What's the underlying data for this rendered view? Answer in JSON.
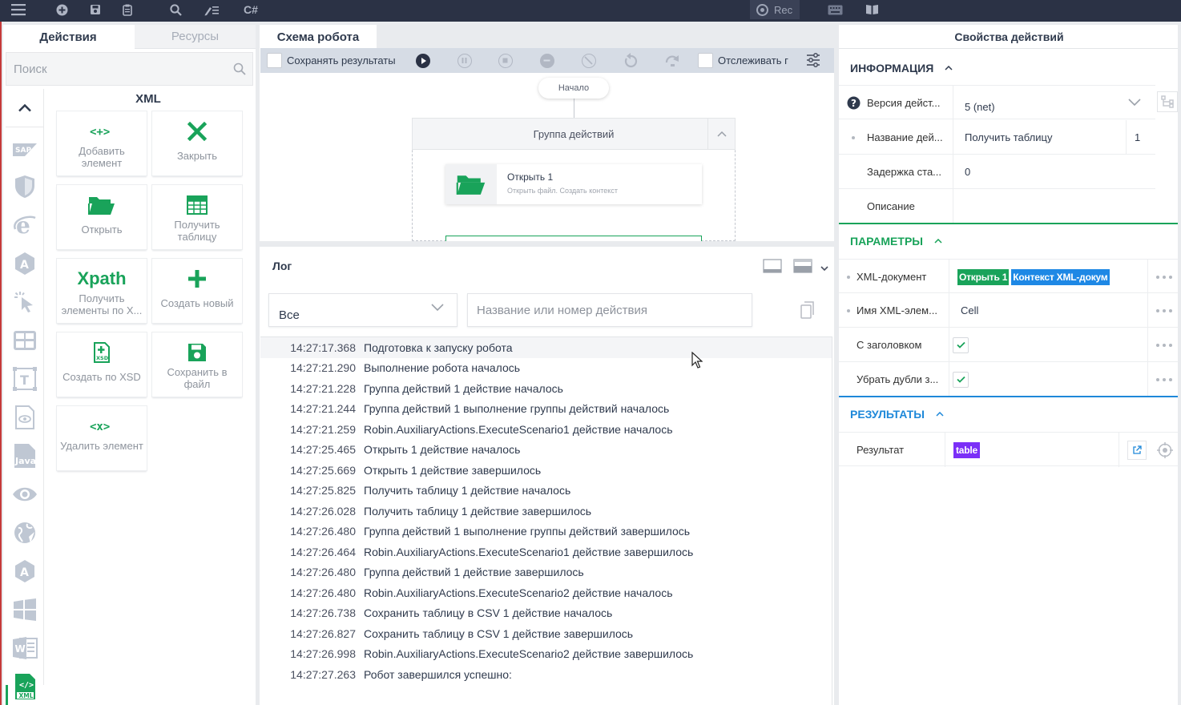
{
  "topbar": {
    "rec_label": "Rec"
  },
  "left_panel": {
    "tabs": [
      "Действия",
      "Ресурсы"
    ],
    "search_placeholder": "Поиск",
    "category_title": "XML",
    "tiles": [
      {
        "label": "Добавить элемент",
        "icon": "add-element-icon"
      },
      {
        "label": "Закрыть",
        "icon": "close-x-icon"
      },
      {
        "label": "Открыть",
        "icon": "folder-open-icon"
      },
      {
        "label": "Получить таблицу",
        "icon": "table-icon"
      },
      {
        "label": "Получить элементы по X...",
        "icon": "xpath-icon",
        "icon_text": "Xpath"
      },
      {
        "label": "Создать новый",
        "icon": "plus-icon"
      },
      {
        "label": "Создать по XSD",
        "icon": "xsd-file-icon"
      },
      {
        "label": "Сохранить в файл",
        "icon": "floppy-icon"
      },
      {
        "label": "Удалить элемент",
        "icon": "remove-element-icon"
      }
    ]
  },
  "schema": {
    "tab_label": "Схема робота",
    "save_results_label": "Сохранять результаты",
    "track_label": "Отслеживать г",
    "start_node": "Начало",
    "group_label": "Группа действий",
    "open_node_title": "Открыть  1",
    "open_node_desc": "Открыть файл. Создать контекст"
  },
  "log": {
    "title": "Лог",
    "filter_value": "Все",
    "search_placeholder": "Название или номер действия",
    "rows": [
      {
        "time": "14:27:17.368",
        "msg": "Подготовка к запуску робота"
      },
      {
        "time": "14:27:21.290",
        "msg": "Выполнение робота началось"
      },
      {
        "time": "14:27:21.228",
        "msg": "Группа действий 1 действие началось"
      },
      {
        "time": "14:27:21.244",
        "msg": "Группа действий 1 выполнение группы действий началось"
      },
      {
        "time": "14:27:21.259",
        "msg": "Robin.AuxiliaryActions.ExecuteScenario1 действие началось"
      },
      {
        "time": "14:27:25.465",
        "msg": "Открыть 1 действие началось"
      },
      {
        "time": "14:27:25.669",
        "msg": "Открыть 1 действие завершилось"
      },
      {
        "time": "14:27:25.825",
        "msg": "Получить таблицу 1 действие началось"
      },
      {
        "time": "14:27:26.028",
        "msg": "Получить таблицу 1 действие завершилось"
      },
      {
        "time": "14:27:26.480",
        "msg": "Группа действий 1 выполнение группы действий завершилось"
      },
      {
        "time": "14:27:26.464",
        "msg": "Robin.AuxiliaryActions.ExecuteScenario1 действие завершилось"
      },
      {
        "time": "14:27:26.480",
        "msg": "Группа действий 1 действие завершилось"
      },
      {
        "time": "14:27:26.480",
        "msg": "Robin.AuxiliaryActions.ExecuteScenario2 действие началось"
      },
      {
        "time": "14:27:26.738",
        "msg": "Сохранить таблицу в CSV 1 действие началось"
      },
      {
        "time": "14:27:26.827",
        "msg": "Сохранить таблицу в CSV 1 действие завершилось"
      },
      {
        "time": "14:27:26.998",
        "msg": "Robin.AuxiliaryActions.ExecuteScenario2 действие завершилось"
      },
      {
        "time": "14:27:27.263",
        "msg": "Робот завершился успешно:"
      }
    ]
  },
  "props": {
    "title": "Свойства действий",
    "info": {
      "header": "ИНФОРМАЦИЯ",
      "version_label": "Версия дейст...",
      "version_value": "5 (net)",
      "name_label": "Название дей...",
      "name_value": "Получить таблицу",
      "name_number": "1",
      "delay_label": "Задержка ста...",
      "delay_value": "0",
      "desc_label": "Описание"
    },
    "params": {
      "header": "ПАРАМЕТРЫ",
      "xml_doc_label": "XML-документ",
      "xml_doc_tag1": "Открыть 1",
      "xml_doc_tag2": "Контекст XML-докум",
      "xml_elem_label": "Имя XML-элем...",
      "xml_elem_value": "Cell",
      "header_label": "С заголовком",
      "dedupe_label": "Убрать дубли з..."
    },
    "results": {
      "header": "РЕЗУЛЬТАТЫ",
      "result_label": "Результат",
      "result_tag": "table"
    }
  },
  "colors": {
    "topbar": "#2b3245",
    "green": "#19a35a",
    "blue_accent": "#1e88d9",
    "tag_blue": "#1e88e5",
    "tag_purple": "#7b2ff7"
  }
}
